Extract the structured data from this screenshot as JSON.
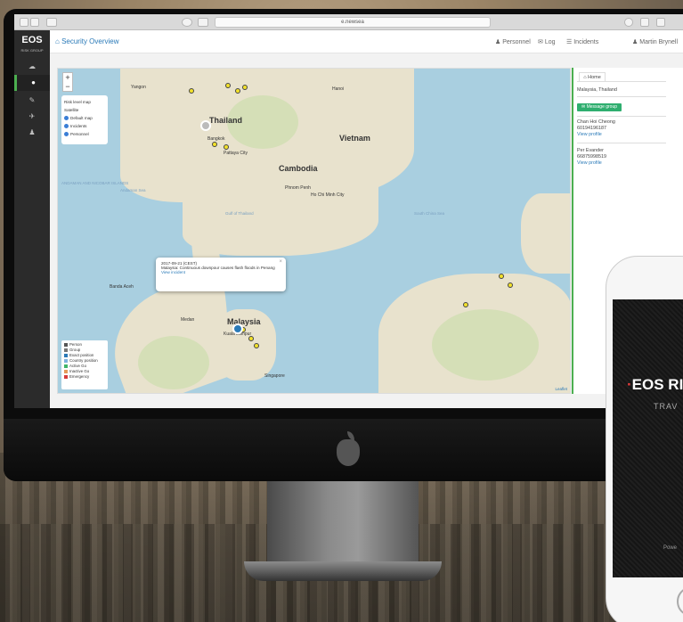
{
  "browser": {
    "url": "e.newsea"
  },
  "sidebar": {
    "logo": "EOS",
    "logo_sub": "RISK GROUP",
    "items": [
      {
        "icon": "dashboard-icon",
        "label": "☁"
      },
      {
        "icon": "globe-icon",
        "label": "●",
        "active": true
      },
      {
        "icon": "edit-icon",
        "label": "✎"
      },
      {
        "icon": "plane-icon",
        "label": "✈"
      },
      {
        "icon": "users-icon",
        "label": "♟"
      }
    ]
  },
  "header": {
    "title": "Security Overview",
    "nav": [
      "Personnel",
      "Log",
      "Incidents"
    ],
    "user": "Martin Brynell"
  },
  "map": {
    "zoom_in": "+",
    "zoom_out": "−",
    "layers": [
      "Risk level map",
      "Satellite",
      "Default map",
      "Incidents",
      "Personnel"
    ],
    "countries": [
      "Thailand",
      "Vietnam",
      "Cambodia",
      "Malaysia"
    ],
    "cities": [
      "Bangkok",
      "Yangon",
      "Hanoi",
      "Phnom Penh",
      "Ho Chi Minh City",
      "Kuala Lumpur",
      "Singapore",
      "Medan",
      "Banda Aceh",
      "Pattaya City"
    ],
    "seas": [
      "Gulf of Thailand",
      "ANDAMAN AND NICOBAR ISLANDS",
      "Andaman Sea",
      "South China Sea"
    ],
    "popup": {
      "date": "2017-09-21 (CEST)",
      "text": "Malaysia: Continuous downpour causes flash floods in Penang",
      "link": "View incident"
    },
    "legend": [
      "Person",
      "Group",
      "Exact position",
      "Country position",
      "Active Go",
      "Inactive Go",
      "Emergency"
    ],
    "attribution": "Leaflet"
  },
  "panel": {
    "tab": "Home",
    "location": "Malaysia, Thailand",
    "message_btn": "Message group",
    "people": [
      {
        "name": "Chan Hoi Cheong",
        "phone": "60194196187",
        "link": "View profile"
      },
      {
        "name": "Per Evander",
        "phone": "66875998519",
        "link": "View profile"
      }
    ]
  },
  "phone": {
    "brand": "EOS RIS",
    "tagline": "TRAV",
    "powered": "Powe"
  },
  "colors": {
    "accent": "#2a7ab8",
    "green": "#4caf50",
    "pin": "#f2e12b",
    "message": "#2fae6f"
  }
}
